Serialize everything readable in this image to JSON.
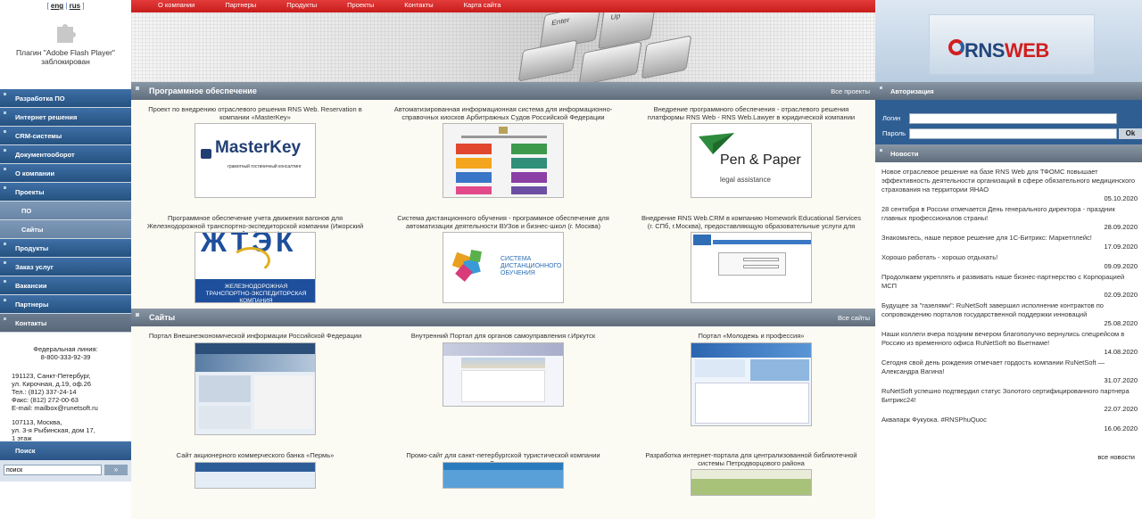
{
  "lang": {
    "eng": "eng",
    "rus": "rus"
  },
  "flash": {
    "line1": "Плагин \"Adobe Flash Player\"",
    "line2": "заблокирован"
  },
  "menu": [
    {
      "label": "Разработка ПО",
      "type": "main"
    },
    {
      "label": "Интернет решения",
      "type": "main"
    },
    {
      "label": "CRM-системы",
      "type": "main"
    },
    {
      "label": "Документооборот",
      "type": "main"
    },
    {
      "label": "О компании",
      "type": "main"
    },
    {
      "label": "Проекты",
      "type": "main"
    },
    {
      "label": "ПО",
      "type": "sub"
    },
    {
      "label": "Сайты",
      "type": "sub"
    },
    {
      "label": "Продукты",
      "type": "main"
    },
    {
      "label": "Заказ услуг",
      "type": "main"
    },
    {
      "label": "Вакансии",
      "type": "main"
    },
    {
      "label": "Партнеры",
      "type": "main"
    },
    {
      "label": "Контакты",
      "type": "last"
    }
  ],
  "contacts": {
    "hotline_label": "Федеральная линия:",
    "hotline": "8-800-333-92-39",
    "spb_addr1": "191123, Санкт-Петербург,",
    "spb_addr2": "ул. Кирочная, д.19, оф.26",
    "tel": "Тел.: (812) 337-24-14",
    "fax": "Факс: (812) 272-00-63",
    "email": "E-mail: mailbox@runetsoft.ru",
    "msk_addr1": "107113, Москва,",
    "msk_addr2": "ул. 3-я Рыбинская, дом 17,",
    "msk_addr3": "1 этаж"
  },
  "search": {
    "title": "Поиск",
    "placeholder": "поиск",
    "go": "»"
  },
  "topnav": [
    "О компании",
    "Партнеры",
    "Продукты",
    "Проекты",
    "Контакты",
    "Карта сайта"
  ],
  "banner": {
    "key1": "Enter",
    "key2": "Up"
  },
  "software": {
    "title": "Программное обеспечение",
    "all": "Все проекты",
    "items": [
      {
        "caption": "Проект по внедрению отраслевого решения RNS Web. Reservation в компании «MasterKey»",
        "logo": "MasterKey",
        "logo_sub": "грамотный гостиничный консалтинг"
      },
      {
        "caption": "Автоматизированная информационная система для информационно-справочных киосков Арбитражных Судов Российской Федерации",
        "logo": "",
        "logo_sub": ""
      },
      {
        "caption": "Внедрение программного обеспечения - отраслевого решения платформы RNS Web - RNS Web.Lawyer в юридической компании Pen&Paper",
        "logo": "Pen & Paper",
        "logo_sub": "legal assistance"
      },
      {
        "caption": "Программное обеспечение учета движения вагонов для Железнодорожной транспортно-экспедиторской компании (Ижорский Трубный Завод)",
        "logo": "ЖТЭК",
        "logo_sub": "ЖЕЛЕЗНОДОРОЖНАЯ ТРАНСПОРТНО-ЭКСПЕДИТОРСКАЯ КОМПАНИЯ"
      },
      {
        "caption": "Система дистанционного обучения - программное обеспечение для автоматизации деятельности ВУЗов и бизнес-школ (г. Москва)",
        "logo": "СИСТЕМА ДИСТАНЦИОННОГО ОБУЧЕНИЯ",
        "logo_sub": ""
      },
      {
        "caption": "Внедрение RNS Web.CRM в компанию Homework Educational Services (г. СПб, г.Москва), предоставляющую образовательные услуги для студентов.",
        "logo": "",
        "logo_sub": ""
      }
    ]
  },
  "sites": {
    "title": "Сайты",
    "all": "Все сайты",
    "items": [
      {
        "caption": "Портал Внешнеэкономической информации Российской Федерации"
      },
      {
        "caption": "Внутренний Портал для органов самоуправления г.Иркутск"
      },
      {
        "caption": "Портал «Молодежь и профессия»"
      },
      {
        "caption": "Сайт акционерного коммерческого банка «Пермь»"
      },
      {
        "caption": "Промо-сайт для санкт-петербургской туристической компании «Спутник»."
      },
      {
        "caption": "Разработка интернет-портала для централизованной библиотечной системы Петродворцового района"
      }
    ]
  },
  "logo": {
    "rns": "RNS",
    "web": "WEB"
  },
  "auth": {
    "title": "Авторизация",
    "login": "Логин",
    "password": "Пароль",
    "ok": "Ok"
  },
  "news": {
    "title": "Новости",
    "all": "все новости",
    "items": [
      {
        "text": "Новое отраслевое решение на базе RNS Web для ТФОМС повышает эффективность деятельности организаций в сфере обязательного медицинского страхования на территории ЯНАО",
        "date": "05.10.2020"
      },
      {
        "text": "28 сентября в России отмечается День генерального директора - праздник главных профессионалов страны!",
        "date": "28.09.2020"
      },
      {
        "text": "Знакомьтесь, наше первое решение для 1С-Битрикс: Маркетплейс!",
        "date": "17.09.2020"
      },
      {
        "text": "Хорошо работать - хорошо отдыхать!",
        "date": "09.09.2020"
      },
      {
        "text": "Продолжаем укреплять и развивать наше бизнес-партнерство с Корпорацией МСП",
        "date": "02.09.2020"
      },
      {
        "text": "Будущее за \"газелями\": RuNetSoft завершил исполнение контрактов по сопровождению порталов государственной поддержки инноваций",
        "date": "25.08.2020"
      },
      {
        "text": "Наши коллеги вчера поздним вечером благополучно вернулись спецрейсом в Россию из временного офиса RuNetSoft во Вьетнаме!",
        "date": "14.08.2020"
      },
      {
        "text": "Сегодня свой день рождения отмечает гордость компании RuNetSoft — Александра Вагина!",
        "date": "31.07.2020"
      },
      {
        "text": "RuNetSoft успешно подтвердил статус Золотого сертифицированного партнера Битрикс24!",
        "date": "22.07.2020"
      },
      {
        "text": "Аквапарк Фукуока. #RNSPhuQuoc",
        "date": "16.06.2020"
      }
    ]
  }
}
